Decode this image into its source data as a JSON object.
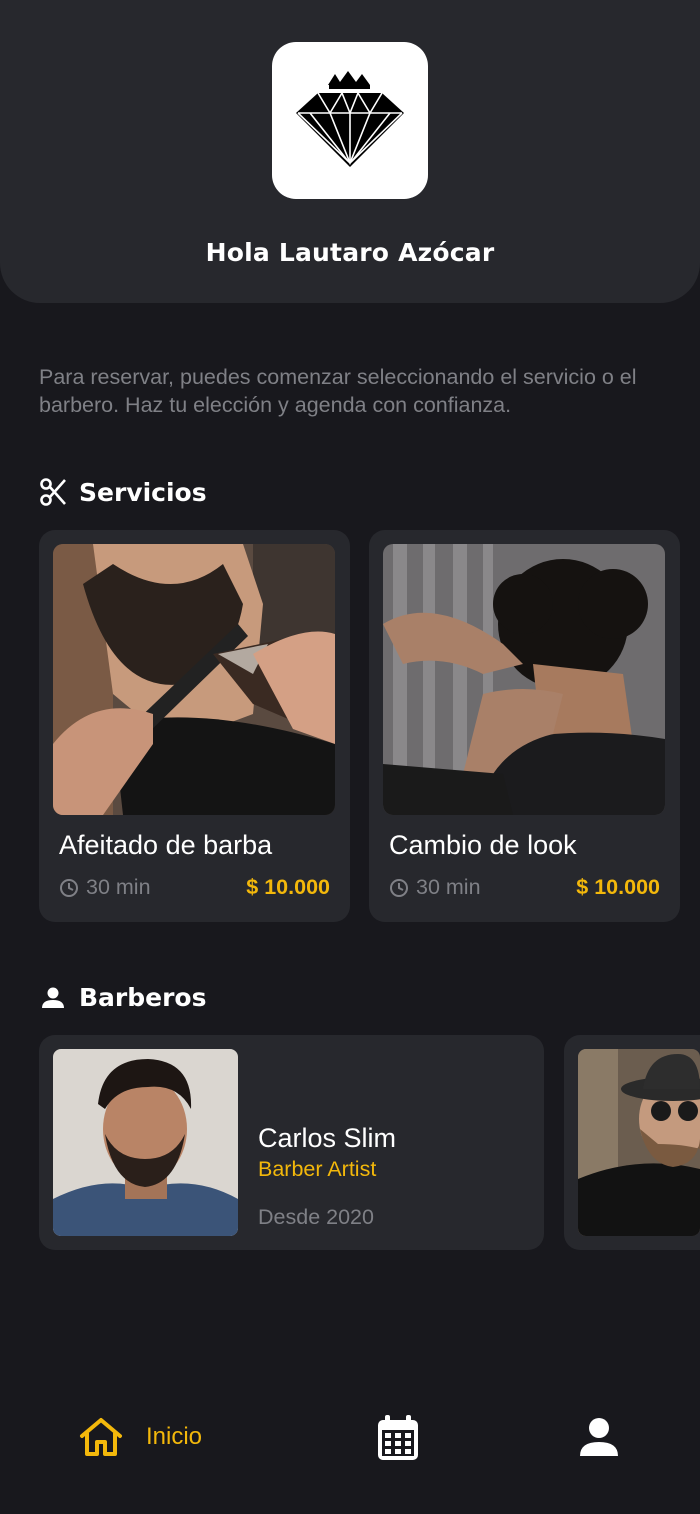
{
  "header": {
    "logo_icon": "diamond-crown-logo",
    "greeting": "Hola Lautaro Azócar"
  },
  "intro_text": "Para reservar, puedes comenzar seleccionando el servicio o el barbero. Haz tu elección y agenda con confianza.",
  "services": {
    "title": "Servicios",
    "icon": "scissors-icon",
    "items": [
      {
        "name": "Afeitado de barba",
        "duration": "30 min",
        "price": "$ 10.000",
        "image": "beard-shave-photo"
      },
      {
        "name": "Cambio de look",
        "duration": "30 min",
        "price": "$ 10.000",
        "image": "haircut-photo"
      }
    ]
  },
  "barbers": {
    "title": "Barberos",
    "icon": "person-icon",
    "items": [
      {
        "name": "Carlos Slim",
        "role": "Barber Artist",
        "since": "Desde 2020",
        "image": "barber-portrait"
      }
    ]
  },
  "nav": {
    "items": [
      {
        "label": "Inicio",
        "icon": "home-icon",
        "active": true
      },
      {
        "label": "",
        "icon": "calendar-icon",
        "active": false
      },
      {
        "label": "",
        "icon": "profile-icon",
        "active": false
      }
    ]
  },
  "colors": {
    "background": "#18181d",
    "card": "#27282d",
    "accent": "#f3b80b",
    "muted_text": "#7f8086"
  }
}
